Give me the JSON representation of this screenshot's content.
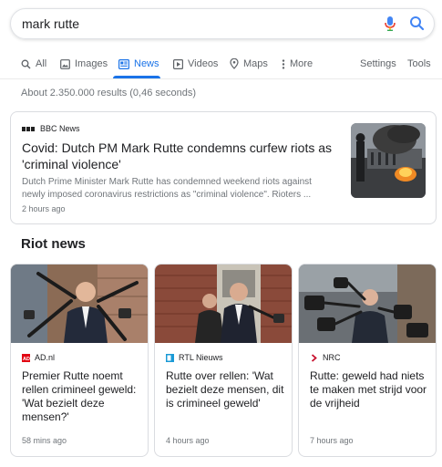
{
  "search": {
    "query": "mark rutte"
  },
  "tabs": [
    {
      "label": "All"
    },
    {
      "label": "Images"
    },
    {
      "label": "News"
    },
    {
      "label": "Videos"
    },
    {
      "label": "Maps"
    },
    {
      "label": "More"
    }
  ],
  "tools": {
    "settings": "Settings",
    "tools": "Tools"
  },
  "stats": "About 2.350.000 results (0,46 seconds)",
  "top_story": {
    "source": "BBC News",
    "title": "Covid: Dutch PM Mark Rutte condemns curfew riots as 'criminal violence'",
    "snippet": "Dutch Prime Minister Mark Rutte has condemned weekend riots against newly imposed coronavirus restrictions as \"criminal violence\". Rioters ...",
    "time": "2 hours ago"
  },
  "section_title": "Riot news",
  "cards": [
    {
      "source": "AD.nl",
      "title": "Premier Rutte noemt rellen crimineel geweld: 'Wat bezielt deze mensen?'",
      "time": "58 mins ago"
    },
    {
      "source": "RTL Nieuws",
      "title": "Rutte over rellen: 'Wat bezielt deze mensen, dit is crimineel geweld'",
      "time": "4 hours ago"
    },
    {
      "source": "NRC",
      "title": "Rutte: geweld had niets te maken met strijd voor de vrijheid",
      "time": "7 hours ago"
    }
  ],
  "colors": {
    "accent": "#1a73e8",
    "ad_red": "#e20613",
    "rtl_blue": "#1a9ad6",
    "nrc_red": "#c8102e"
  }
}
